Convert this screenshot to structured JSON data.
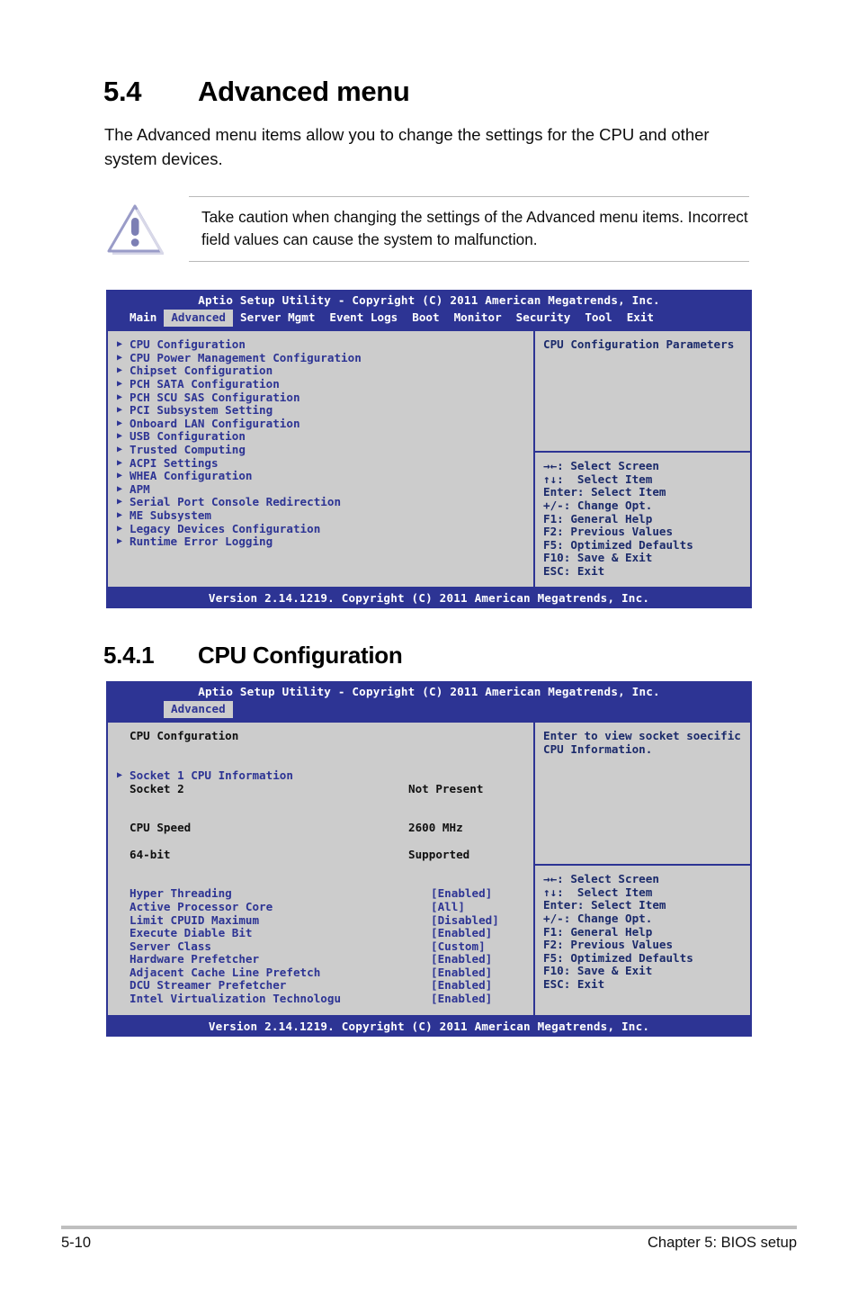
{
  "document": {
    "section": {
      "number": "5.4",
      "title": "Advanced menu"
    },
    "intro": "The Advanced menu items allow you to change the settings for the CPU and other system devices.",
    "caution": {
      "icon": "warning-triangle-icon",
      "text": "Take caution when changing the settings of the Advanced menu items. Incorrect field values can cause the system to malfunction."
    },
    "subsection": {
      "number": "5.4.1",
      "title": "CPU Configuration"
    },
    "footer": {
      "page_number": "5-10",
      "chapter": "Chapter 5: BIOS setup"
    }
  },
  "colors": {
    "bios_blue": "#2d3494",
    "bios_gray": "#cccccc",
    "warning_purple": "#8b8ec4"
  },
  "bios_advanced": {
    "titlebar": "Aptio Setup Utility - Copyright (C) 2011 American Megatrends, Inc.",
    "tabs": [
      {
        "label": "Main",
        "active": false
      },
      {
        "label": "Advanced",
        "active": true
      },
      {
        "label": "Server Mgmt",
        "active": false
      },
      {
        "label": "Event Logs",
        "active": false
      },
      {
        "label": "Boot",
        "active": false
      },
      {
        "label": "Monitor",
        "active": false
      },
      {
        "label": "Security",
        "active": false
      },
      {
        "label": "Tool",
        "active": false
      },
      {
        "label": "Exit",
        "active": false
      }
    ],
    "menu_items": [
      "CPU Configuration",
      "CPU Power Management Configuration",
      "Chipset Configuration",
      "PCH SATA Configuration",
      "PCH SCU SAS Configuration",
      "PCI Subsystem Setting",
      "Onboard LAN Configuration",
      "USB Configuration",
      "Trusted Computing",
      "ACPI Settings",
      "WHEA Configuration",
      "APM",
      "Serial Port Console Redirection",
      "ME Subsystem",
      "Legacy Devices Configuration",
      "Runtime Error Logging"
    ],
    "help_text": [
      "CPU Configuration Parameters"
    ],
    "key_help": [
      "→←: Select Screen",
      "↑↓:  Select Item",
      "Enter: Select Item",
      "+/-: Change Opt.",
      "F1: General Help",
      "F2: Previous Values",
      "F5: Optimized Defaults",
      "F10: Save & Exit",
      "ESC: Exit"
    ],
    "footer": "Version 2.14.1219. Copyright (C) 2011 American Megatrends, Inc."
  },
  "bios_cpu": {
    "titlebar": "Aptio Setup Utility - Copyright (C) 2011 American Megatrends, Inc.",
    "tabs": [
      {
        "label": "Advanced",
        "active": true
      }
    ],
    "page_title": "CPU Confguration",
    "submenu_item": "Socket 1 CPU Information",
    "info_rows": [
      {
        "key": "Socket 2",
        "value": "Not Present"
      },
      {
        "key": "CPU Speed",
        "value": "2600 MHz"
      },
      {
        "key": "64-bit",
        "value": "Supported"
      }
    ],
    "settings": [
      {
        "key": "Hyper Threading",
        "value": "[Enabled]"
      },
      {
        "key": "Active Processor Core",
        "value": "[All]"
      },
      {
        "key": "Limit CPUID Maximum",
        "value": "[Disabled]"
      },
      {
        "key": "Execute Diable Bit",
        "value": "[Enabled]"
      },
      {
        "key": "Server Class",
        "value": "[Custom]"
      },
      {
        "key": "Hardware Prefetcher",
        "value": "[Enabled]"
      },
      {
        "key": "Adjacent Cache Line Prefetch",
        "value": "[Enabled]"
      },
      {
        "key": "DCU Streamer Prefetcher",
        "value": "[Enabled]"
      },
      {
        "key": "Intel Virtualization Technologu",
        "value": "[Enabled]"
      }
    ],
    "help_text": [
      "Enter to view socket soecific",
      "CPU Information."
    ],
    "key_help": [
      "→←: Select Screen",
      "↑↓:  Select Item",
      "Enter: Select Item",
      "+/-: Change Opt.",
      "F1: General Help",
      "F2: Previous Values",
      "F5: Optimized Defaults",
      "F10: Save & Exit",
      "ESC: Exit"
    ],
    "footer": "Version 2.14.1219. Copyright (C) 2011 American Megatrends, Inc."
  }
}
